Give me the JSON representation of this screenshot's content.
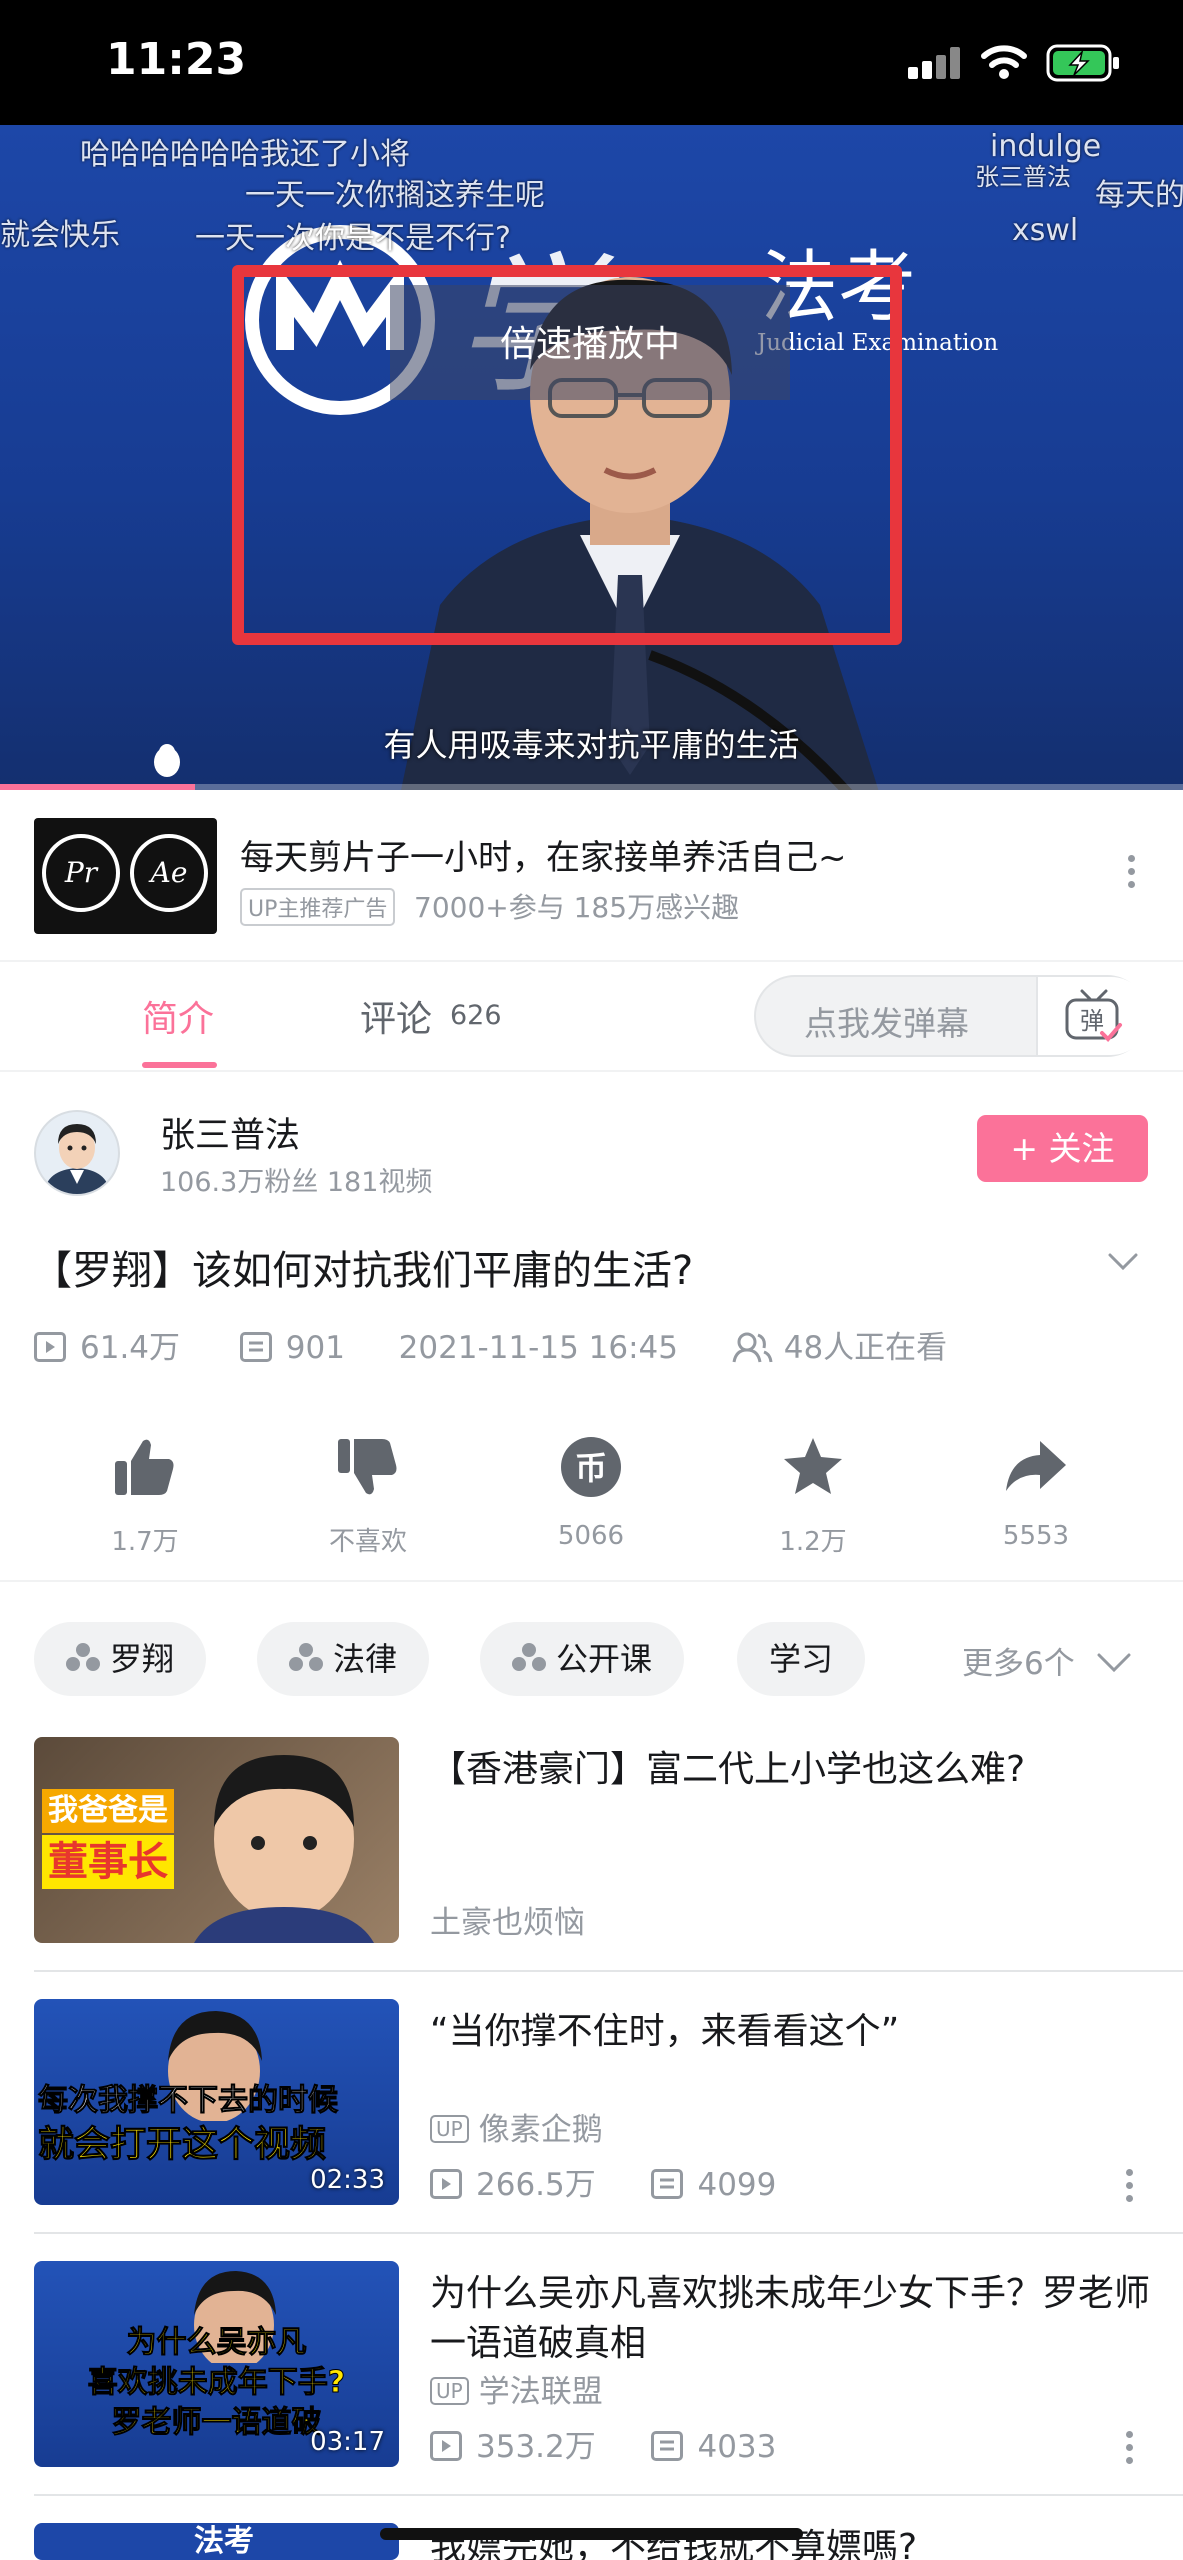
{
  "status_bar": {
    "time": "11:23"
  },
  "player": {
    "danmaku": [
      "哈哈哈哈哈哈我还了小将",
      "一天一次你搁这养生呢",
      "就会快乐",
      "一天一次你是不是不行?",
      "indulge",
      "张三普法",
      "每天的",
      "xswl"
    ],
    "logo_text": "法考",
    "logo_sub": "Judicial Examination",
    "speed_toast": "倍速播放中",
    "subtitle": "有人用吸毒来对抗平庸的生活",
    "progress_fraction": 0.165
  },
  "ad": {
    "thumb_labels": [
      "Pr",
      "Ae"
    ],
    "title": "每天剪片子一小时，在家接单养活自己~",
    "badge": "UP主推荐广告",
    "stats": "7000+参与  185万感兴趣"
  },
  "tabs": {
    "intro": "简介",
    "comments": "评论",
    "comment_count": "626",
    "danmaku_placeholder": "点我发弹幕",
    "danmaku_button": "弹"
  },
  "uploader": {
    "name": "张三普法",
    "stats": "106.3万粉丝  181视频",
    "follow": "+ 关注"
  },
  "video": {
    "title": "【罗翔】该如何对抗我们平庸的生活?",
    "views": "61.4万",
    "danmaku_count": "901",
    "date": "2021-11-15  16:45",
    "watching": "48人正在看"
  },
  "actions": [
    {
      "label": "1.7万",
      "icon": "thumbs-up-icon"
    },
    {
      "label": "不喜欢",
      "icon": "thumbs-down-icon"
    },
    {
      "label": "5066",
      "icon": "coin-icon"
    },
    {
      "label": "1.2万",
      "icon": "star-icon"
    },
    {
      "label": "5553",
      "icon": "share-icon"
    }
  ],
  "tags": {
    "items": [
      "罗翔",
      "法律",
      "公开课",
      "学习"
    ],
    "more": "更多6个"
  },
  "related": [
    {
      "title": "【香港豪门】富二代上小学也这么难?",
      "author": "土豪也烦恼",
      "thumb_text": [
        "我爸爸是",
        "董事长"
      ],
      "duration": "",
      "views": "",
      "danmaku": ""
    },
    {
      "title": "“当你撑不住时，来看看这个”",
      "author": "像素企鹅",
      "thumb_text": [
        "每次我撑不下去的时候",
        "就会打开这个视频"
      ],
      "duration": "02:33",
      "views": "266.5万",
      "danmaku": "4099"
    },
    {
      "title": "为什么吴亦凡喜欢挑未成年少女下手？罗老师一语道破真相",
      "author": "学法联盟",
      "thumb_text": [
        "为什么吴亦凡",
        "喜欢挑未成年下手?",
        "罗老师一语道破"
      ],
      "duration": "03:17",
      "views": "353.2万",
      "danmaku": "4033"
    },
    {
      "title": "我嫖完她，不给钱就不算嫖嗎?",
      "author": "",
      "thumb_text": [
        "法考"
      ],
      "duration": "",
      "views": "",
      "danmaku": ""
    }
  ],
  "up_badge": "UP",
  "colors": {
    "accent": "#fb7299",
    "video_bg": "#1d47a8",
    "highlight_box": "#e8363d"
  }
}
